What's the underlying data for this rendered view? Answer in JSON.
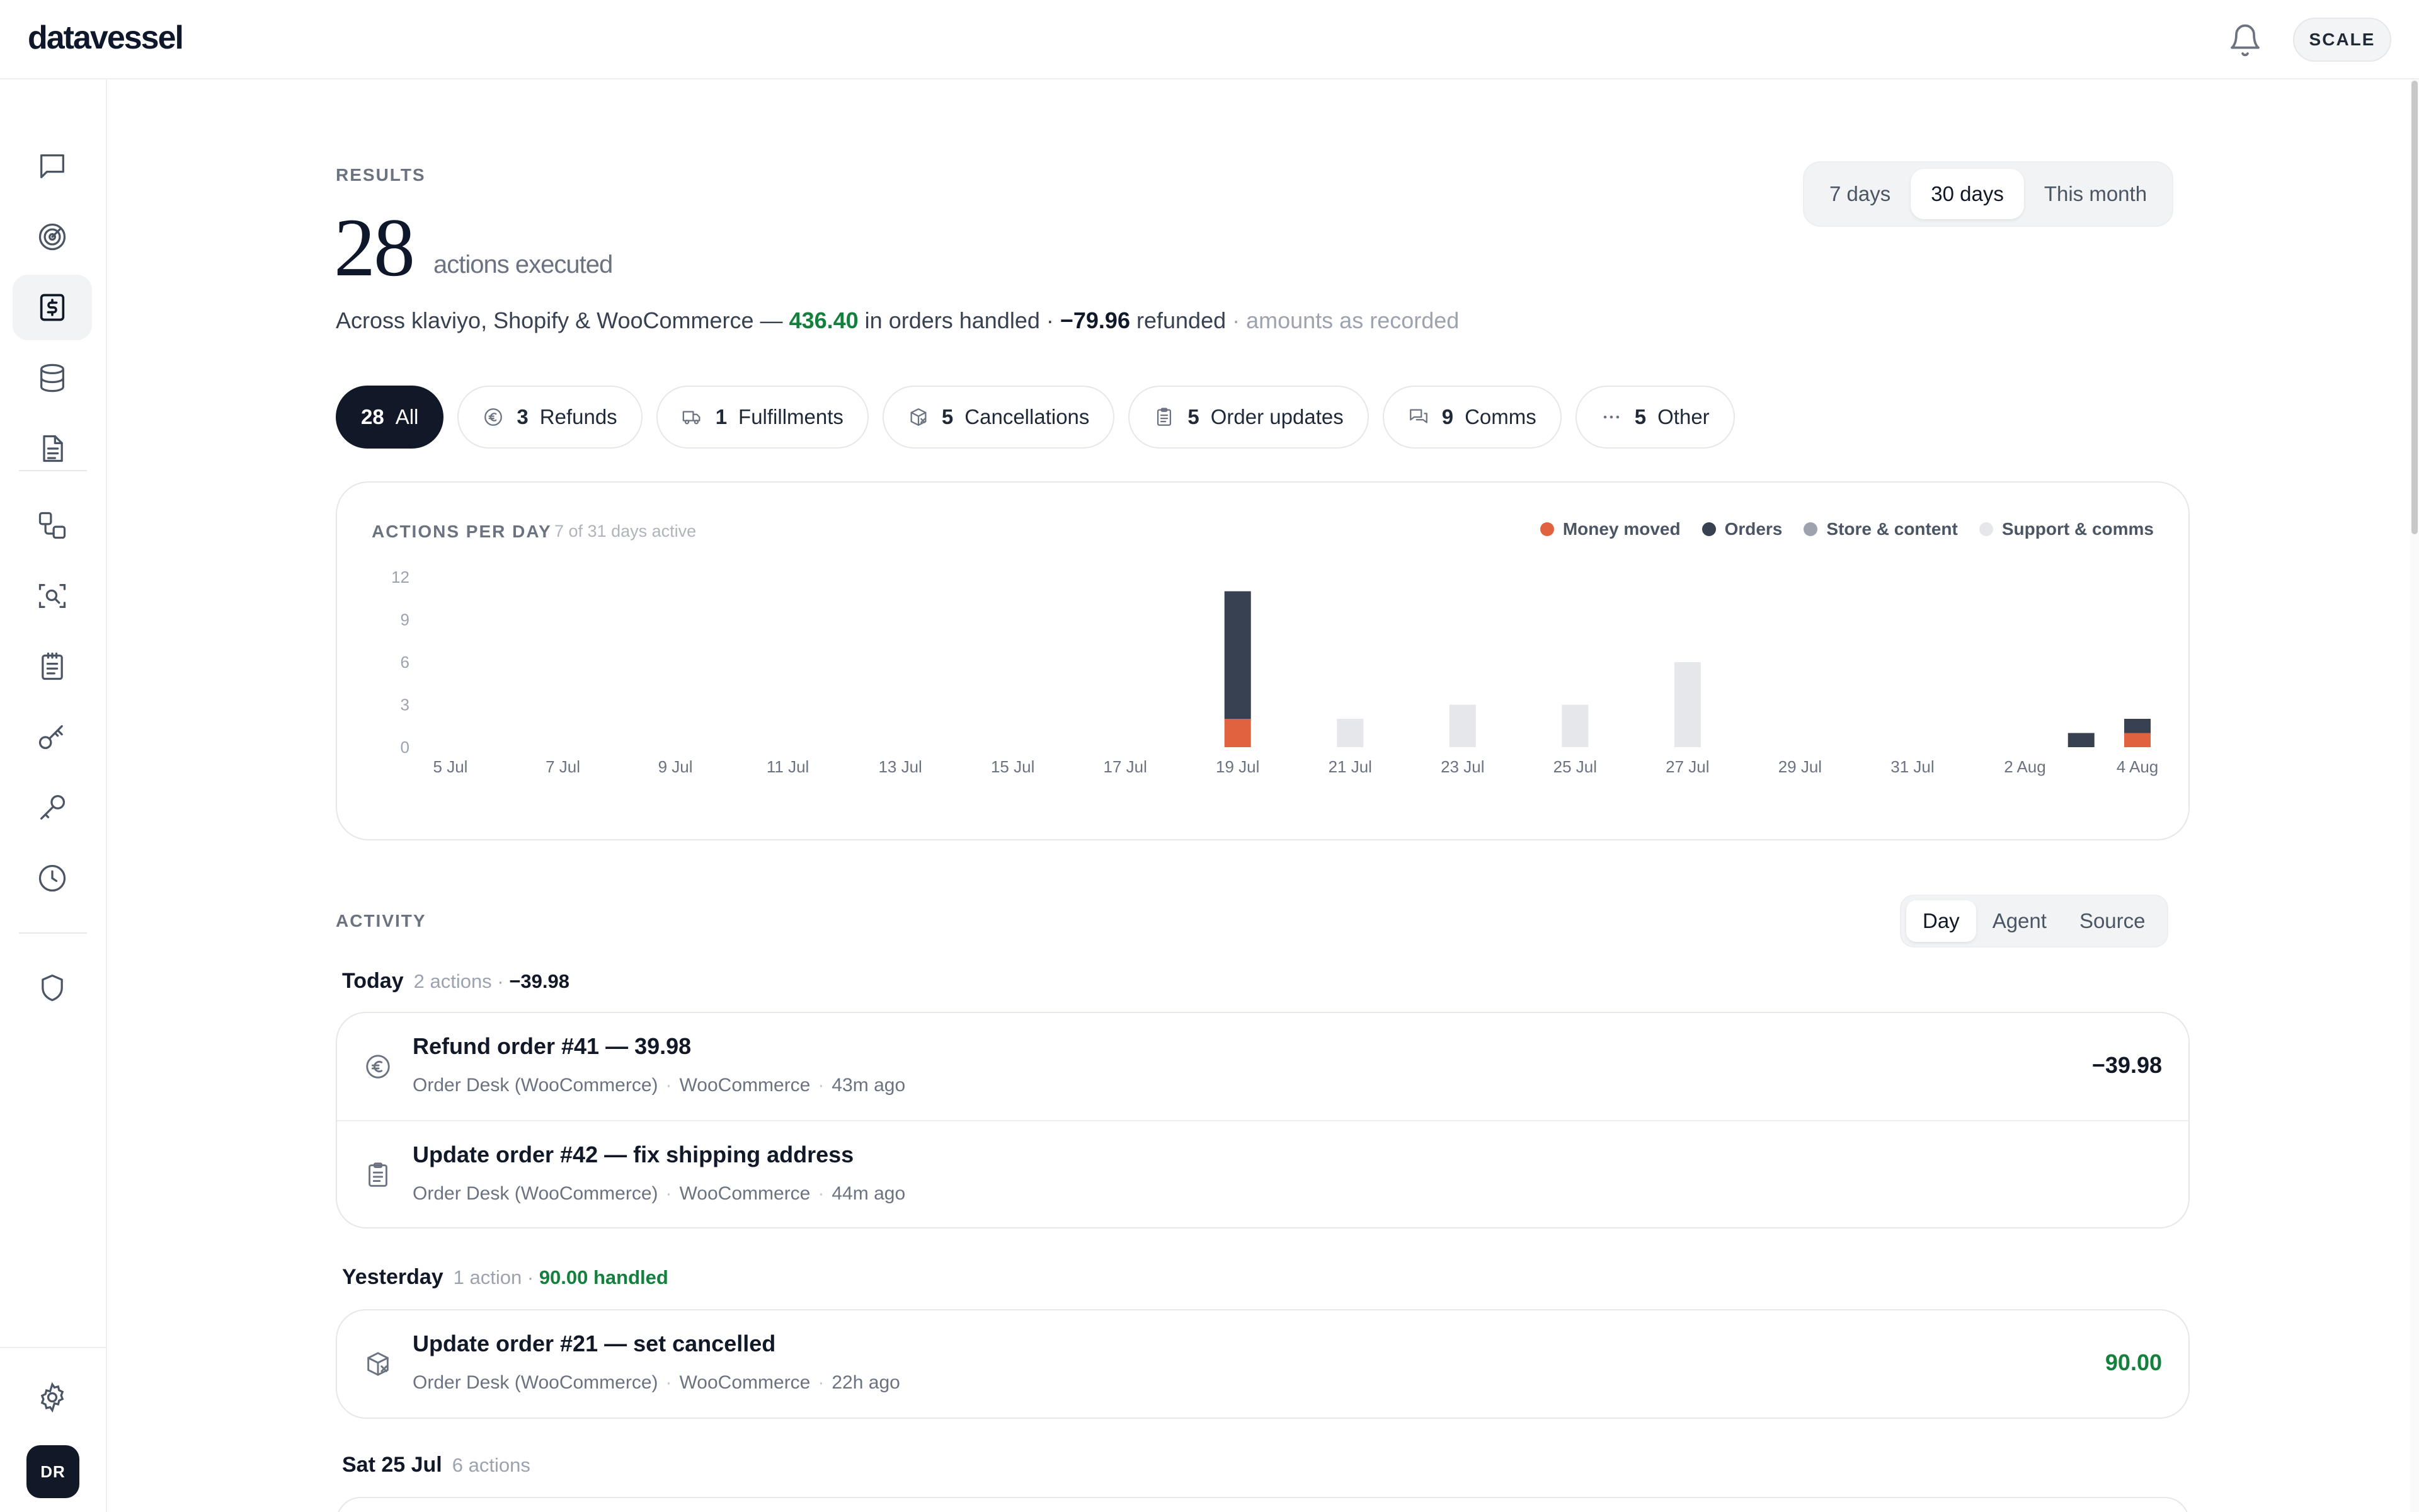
{
  "app": {
    "logo": "datavessel",
    "plan_badge": "SCALE",
    "user_initials": "DR"
  },
  "sidebar": {
    "items": [
      {
        "name": "chat-icon",
        "label": "Chat"
      },
      {
        "name": "radar-icon",
        "label": "Radar"
      },
      {
        "name": "dollar-receipt-icon",
        "label": "Results",
        "active": true
      },
      {
        "name": "database-icon",
        "label": "Data"
      },
      {
        "name": "document-icon",
        "label": "Documents"
      },
      {
        "name": "workflow-icon",
        "label": "Workflows"
      },
      {
        "name": "scan-search-icon",
        "label": "Scan"
      },
      {
        "name": "clipboard-list-icon",
        "label": "Tasks"
      },
      {
        "name": "key-icon",
        "label": "Keys"
      },
      {
        "name": "wrench-icon",
        "label": "Tools"
      },
      {
        "name": "clock-icon",
        "label": "History"
      },
      {
        "name": "shield-icon",
        "label": "Security"
      },
      {
        "name": "gear-icon",
        "label": "Settings"
      }
    ]
  },
  "results": {
    "section_label": "RESULTS",
    "count": "28",
    "count_suffix": "actions executed",
    "summary": {
      "prefix": "Across klaviyo, Shopify & WooCommerce — ",
      "handled_amount": "436.40",
      "handled_text": " in orders handled · ",
      "refunded_amount": "−79.96",
      "refunded_text": " refunded",
      "note": " · amounts as recorded"
    },
    "range_options": [
      "7 days",
      "30 days",
      "This month"
    ],
    "range_selected": "30 days",
    "filters": [
      {
        "count": "28",
        "label": "All",
        "icon": "none",
        "active": true
      },
      {
        "count": "3",
        "label": "Refunds",
        "icon": "euro-circle-icon"
      },
      {
        "count": "1",
        "label": "Fulfillments",
        "icon": "truck-icon"
      },
      {
        "count": "5",
        "label": "Cancellations",
        "icon": "package-x-icon"
      },
      {
        "count": "5",
        "label": "Order updates",
        "icon": "clipboard-icon"
      },
      {
        "count": "9",
        "label": "Comms",
        "icon": "chat-bubbles-icon"
      },
      {
        "count": "5",
        "label": "Other",
        "icon": "ellipsis-icon"
      }
    ]
  },
  "chart_data": {
    "type": "bar",
    "title": "ACTIONS PER DAY",
    "subtitle": "7 of 31 days active",
    "stacked": true,
    "ylim": [
      0,
      12
    ],
    "yticks": [
      0,
      3,
      6,
      9,
      12
    ],
    "categories": [
      "5 Jul",
      "6 Jul",
      "7 Jul",
      "8 Jul",
      "9 Jul",
      "10 Jul",
      "11 Jul",
      "12 Jul",
      "13 Jul",
      "14 Jul",
      "15 Jul",
      "16 Jul",
      "17 Jul",
      "18 Jul",
      "19 Jul",
      "20 Jul",
      "21 Jul",
      "22 Jul",
      "23 Jul",
      "24 Jul",
      "25 Jul",
      "26 Jul",
      "27 Jul",
      "28 Jul",
      "29 Jul",
      "30 Jul",
      "31 Jul",
      "1 Aug",
      "2 Aug",
      "3 Aug",
      "4 Aug"
    ],
    "xtick_labels": [
      "5 Jul",
      "7 Jul",
      "9 Jul",
      "11 Jul",
      "13 Jul",
      "15 Jul",
      "17 Jul",
      "19 Jul",
      "21 Jul",
      "23 Jul",
      "25 Jul",
      "27 Jul",
      "29 Jul",
      "31 Jul",
      "2 Aug",
      "4 Aug"
    ],
    "series": [
      {
        "name": "Money moved",
        "color": "#e0623e",
        "values": [
          0,
          0,
          0,
          0,
          0,
          0,
          0,
          0,
          0,
          0,
          0,
          0,
          0,
          0,
          2,
          0,
          0,
          0,
          0,
          0,
          0,
          0,
          0,
          0,
          0,
          0,
          0,
          0,
          0,
          0,
          1
        ]
      },
      {
        "name": "Orders",
        "color": "#374151",
        "values": [
          0,
          0,
          0,
          0,
          0,
          0,
          0,
          0,
          0,
          0,
          0,
          0,
          0,
          0,
          9,
          0,
          0,
          0,
          0,
          0,
          0,
          0,
          0,
          0,
          0,
          0,
          0,
          0,
          0,
          1,
          1
        ]
      },
      {
        "name": "Store & content",
        "color": "#9ca3af",
        "values": [
          0,
          0,
          0,
          0,
          0,
          0,
          0,
          0,
          0,
          0,
          0,
          0,
          0,
          0,
          0,
          0,
          0,
          0,
          0,
          0,
          0,
          0,
          0,
          0,
          0,
          0,
          0,
          0,
          0,
          0,
          0
        ]
      },
      {
        "name": "Support & comms",
        "color": "#e5e7eb",
        "values": [
          0,
          0,
          0,
          0,
          0,
          0,
          0,
          0,
          0,
          0,
          0,
          0,
          0,
          0,
          0,
          0,
          2,
          0,
          3,
          0,
          3,
          0,
          6,
          0,
          0,
          0,
          0,
          0,
          0,
          0,
          0
        ]
      }
    ],
    "legend_position": "top-right",
    "grid": false
  },
  "activity": {
    "section_label": "ACTIVITY",
    "group_options": [
      "Day",
      "Agent",
      "Source"
    ],
    "group_selected": "Day",
    "groups": [
      {
        "day": "Today",
        "meta": "2 actions",
        "amount": "−39.98",
        "rows": [
          {
            "icon": "euro-circle-icon",
            "title": "Refund order #41 — 39.98",
            "agent": "Order Desk (WooCommerce)",
            "source": "WooCommerce",
            "time": "43m ago",
            "amount": "−39.98"
          },
          {
            "icon": "clipboard-icon",
            "title": "Update order #42 — fix shipping address",
            "agent": "Order Desk (WooCommerce)",
            "source": "WooCommerce",
            "time": "44m ago",
            "amount": ""
          }
        ]
      },
      {
        "day": "Yesterday",
        "meta": "1 action",
        "amount": "90.00 handled",
        "rows": [
          {
            "icon": "package-x-icon",
            "title": "Update order #21 — set cancelled",
            "agent": "Order Desk (WooCommerce)",
            "source": "WooCommerce",
            "time": "22h ago",
            "amount": "90.00"
          }
        ]
      },
      {
        "day": "Sat 25 Jul",
        "meta": "6 actions"
      }
    ]
  }
}
